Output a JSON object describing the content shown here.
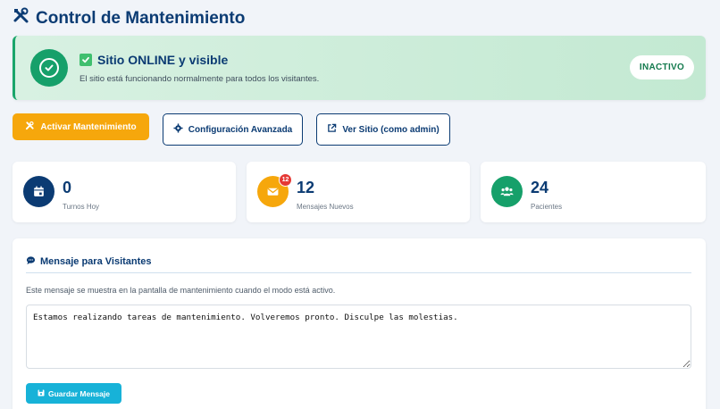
{
  "page": {
    "title": "Control de Mantenimiento",
    "title_icon": "tools-icon"
  },
  "status": {
    "title": "Sitio ONLINE y visible",
    "description": "El sitio está funcionando normalmente para todos los visitantes.",
    "toggle_label": "INACTIVO",
    "icon": "check-circle-icon",
    "emoji_icon": "check-box-icon",
    "accent": "#16a06a"
  },
  "actions": {
    "maintenance_label": "Activar Mantenimiento",
    "config_label": "Configuración Avanzada",
    "view_site_label": "Ver Sitio (como admin)"
  },
  "stats": [
    {
      "value": "0",
      "label": "Turnos Hoy",
      "icon": "calendar-icon",
      "color": "#0b3b73"
    },
    {
      "value": "12",
      "label": "Mensajes Nuevos",
      "icon": "envelope-icon",
      "color": "#f6a70c",
      "badge": "12"
    },
    {
      "value": "24",
      "label": "Pacientes",
      "icon": "users-icon",
      "color": "#16a06a"
    }
  ],
  "message_panel": {
    "title": "Mensaje para Visitantes",
    "description": "Este mensaje se muestra en la pantalla de mantenimiento cuando el modo está activo.",
    "message_value": "Estamos realizando tareas de mantenimiento. Volveremos pronto. Disculpe las molestias.",
    "save_label": "Guardar Mensaje"
  }
}
